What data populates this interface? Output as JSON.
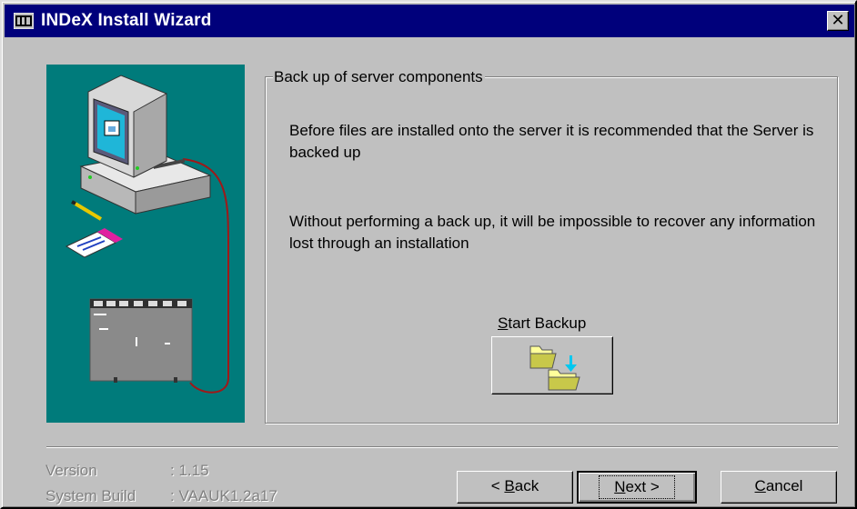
{
  "window": {
    "title": "INDeX Install Wizard",
    "close_glyph": "✕"
  },
  "group": {
    "title": "Back up of server components",
    "paragraph1": "Before files are installed onto the server it is recommended that the Server is backed up",
    "paragraph2": "Without performing a back up, it will be impossible to recover any information lost through an installation"
  },
  "backup": {
    "label_mnemonic": "S",
    "label_rest": "tart Backup",
    "icon": "folder-copy-icon"
  },
  "version": {
    "version_label": "Version",
    "version_value": ": 1.15",
    "build_label": "System Build",
    "build_value": ": VAAUK1.2a17"
  },
  "buttons": {
    "back_prefix": "< ",
    "back_mnemonic": "B",
    "back_rest": "ack",
    "next_mnemonic": "N",
    "next_rest": "ext >",
    "cancel_mnemonic": "C",
    "cancel_rest": "ancel"
  },
  "colors": {
    "titlebar": "#00007b",
    "face": "#c0c0c0",
    "illustration_bg": "#007b7b"
  }
}
